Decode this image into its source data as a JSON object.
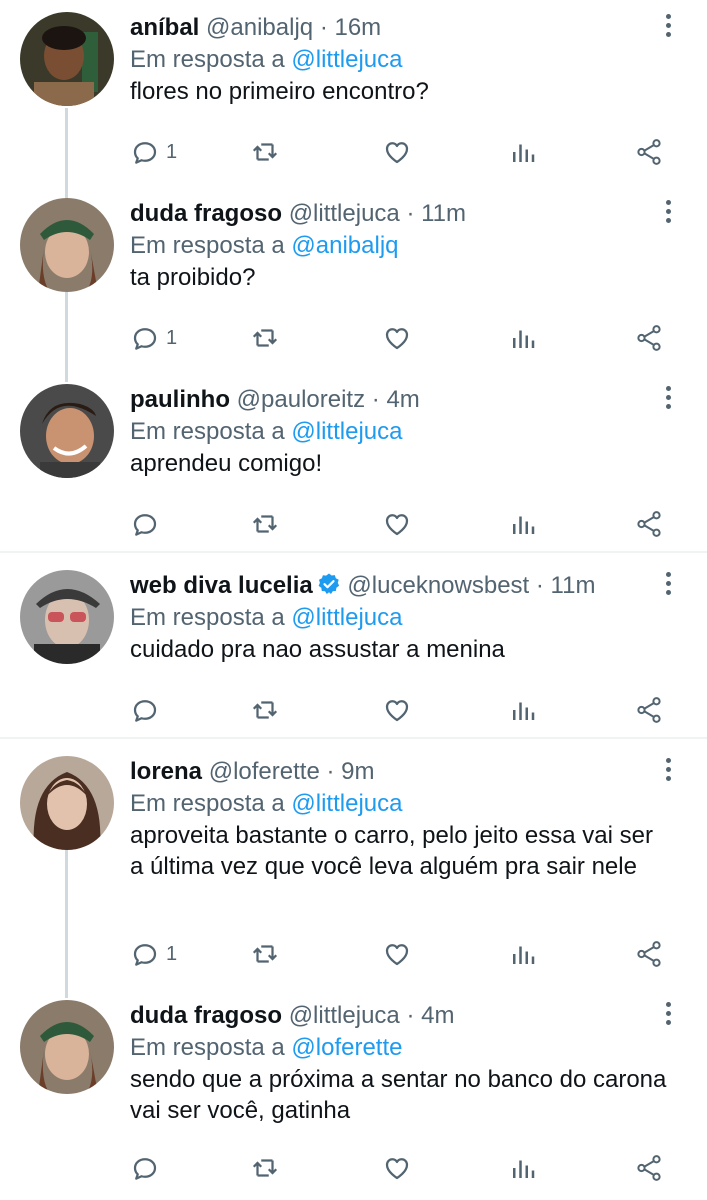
{
  "tweets": [
    {
      "name": "aníbal",
      "handle": "@anibaljq",
      "time": "16m",
      "reply_prefix": "Em resposta a",
      "reply_to": "@littlejuca",
      "text": "flores no primeiro encontro?",
      "reply_count": "1",
      "avatar": "man with bottle"
    },
    {
      "name": "duda fragoso",
      "handle": "@littlejuca",
      "time": "11m",
      "reply_prefix": "Em resposta a",
      "reply_to": "@anibaljq",
      "text": "ta proibido?",
      "reply_count": "1",
      "avatar": "woman with green cap"
    },
    {
      "name": "paulinho",
      "handle": "@pauloreitz",
      "time": "4m",
      "reply_prefix": "Em resposta a",
      "reply_to": "@littlejuca",
      "text": "aprendeu comigo!",
      "reply_count": "",
      "avatar": "smiling man"
    },
    {
      "name": "web diva lucelia",
      "handle": "@luceknowsbest",
      "time": "11m",
      "reply_prefix": "Em resposta a",
      "reply_to": "@littlejuca",
      "text": "cuidado pra nao assustar a menina",
      "reply_count": "",
      "avatar": "person with sunglasses",
      "verified": true
    },
    {
      "name": "lorena",
      "handle": "@loferette",
      "time": "9m",
      "reply_prefix": "Em resposta a",
      "reply_to": "@littlejuca",
      "text": "aproveita bastante o carro, pelo jeito essa vai ser a última vez que você leva alguém pra sair nele",
      "reply_count": "1",
      "avatar": "woman with dark hair"
    },
    {
      "name": "duda fragoso",
      "handle": "@littlejuca",
      "time": "4m",
      "reply_prefix": "Em resposta a",
      "reply_to": "@loferette",
      "text": "sendo que a próxima a sentar no banco do carona vai ser você, gatinha",
      "reply_count": "",
      "avatar": "woman with green cap"
    }
  ],
  "separator": "·",
  "colors": {
    "text": "#0f1419",
    "secondary": "#536471",
    "accent": "#1d9bf0",
    "divider": "#eff3f4",
    "thread_line": "#cfd9de"
  },
  "icons": [
    "reply-icon",
    "retweet-icon",
    "like-icon",
    "analytics-icon",
    "share-icon",
    "more-icon",
    "verified-icon"
  ]
}
